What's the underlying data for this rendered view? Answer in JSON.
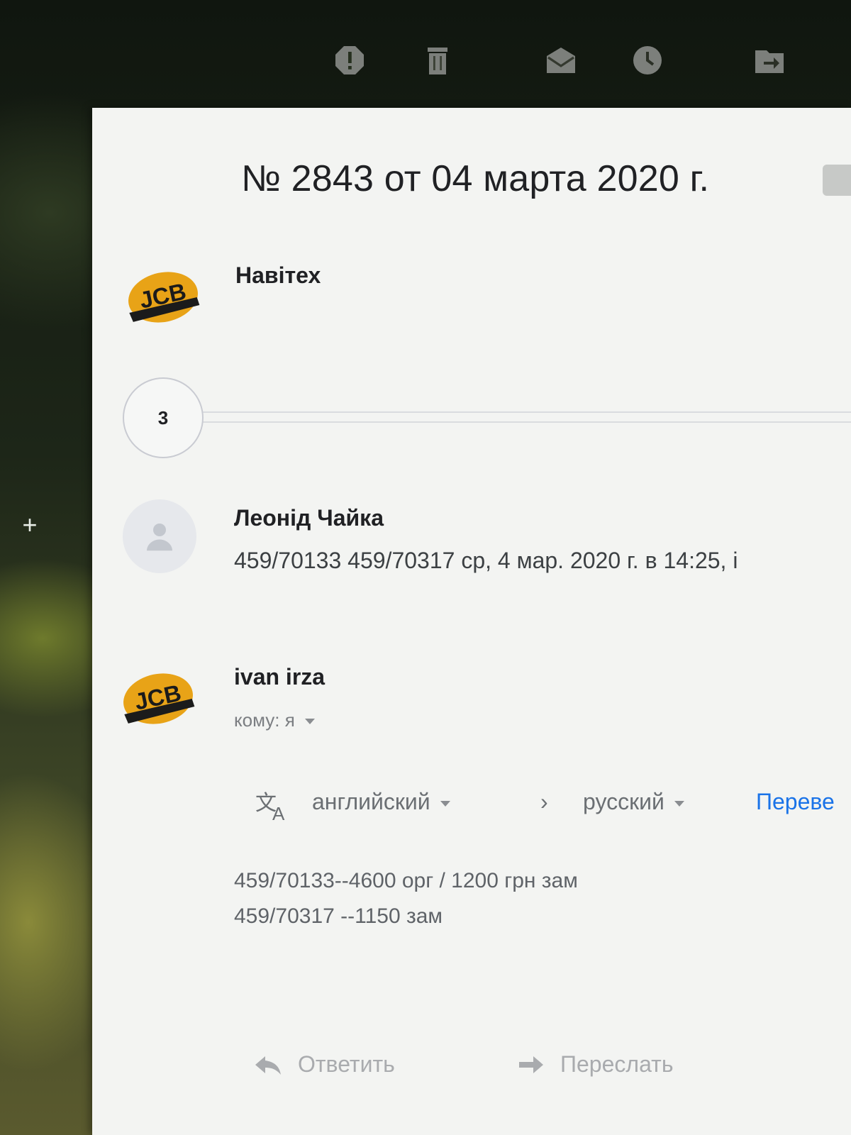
{
  "toolbar": {
    "icons": [
      "report-spam-icon",
      "delete-icon",
      "mark-unread-icon",
      "snooze-icon",
      "move-to-icon"
    ]
  },
  "thread": {
    "subject": "№ 2843 от 04 марта 2020 г."
  },
  "messages": [
    {
      "sender": "Навітех",
      "avatar": "JCB"
    },
    {
      "collapsed_count": "3"
    },
    {
      "sender": "Леонід Чайка",
      "snippet": "459/70133 459/70317 ср, 4 мар. 2020 г. в 14:25, i"
    },
    {
      "sender": "ivan irza",
      "avatar": "JCB",
      "to_label": "кому: я",
      "translate": {
        "from": "английский",
        "to": "русский",
        "action": "Переве"
      },
      "body_lines": [
        "459/70133--4600 орг /  1200 грн зам",
        "459/70317 --1150 зам"
      ]
    }
  ],
  "actions": {
    "reply": "Ответить",
    "forward": "Переслать"
  },
  "colors": {
    "panel": "#f3f4f2",
    "link": "#1a73e8",
    "logo_orange": "#e8a317"
  }
}
